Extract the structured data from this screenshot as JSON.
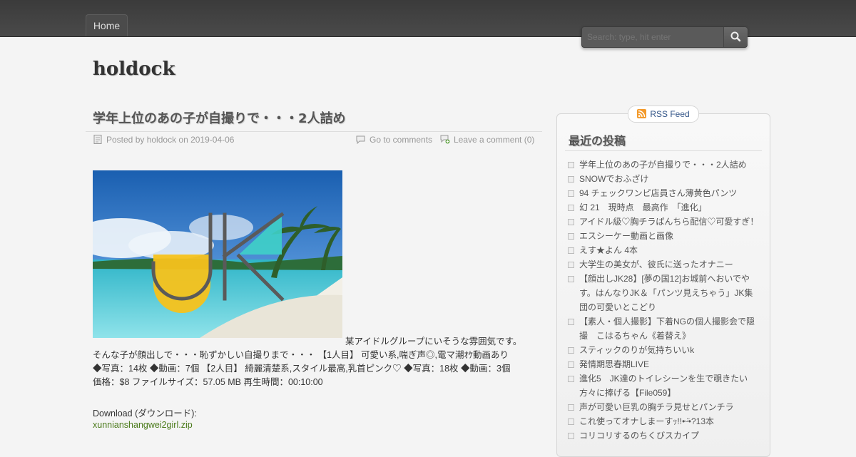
{
  "nav": {
    "home": "Home"
  },
  "search": {
    "placeholder": "Search: type, hit enter"
  },
  "site": {
    "title": "holdock"
  },
  "post": {
    "title": "学年上位のあの子が自撮りで・・・2人詰め",
    "posted_by": "Posted by holdock on 2019-04-06",
    "go_to_comments": "Go to comments",
    "leave_comment": "Leave a comment (0)",
    "image_label": "JK",
    "body_lines": [
      "某アイドルグループにいそうな雰囲気です。",
      "そんな子が顔出しで・・・恥ずかしい自撮りまで・・・ 【1人目】 可愛い系,喘ぎ声◎,電マ潮ｵｹ動画あり",
      "◆写真：14枚 ◆動画：7個 【2人目】 綺麗清楚系,スタイル最高,乳首ピンク♡ ◆写真：18枚 ◆動画：3個",
      "価格：$8 ファイルサイズ：57.05 MB 再生時間：00:10:00"
    ],
    "download_label": "Download (ダウンロード):",
    "download_link": "xunnianshangwei2girl.zip"
  },
  "sidebar": {
    "rss": "RSS Feed",
    "title": "最近の投稿",
    "items": [
      "学年上位のあの子が自撮りで・・・2人詰め",
      "SNOWでおふざけ",
      "94 チェックワンピ店員さん薄黄色パンツ",
      "幻 21　現時点　最高作　「進化」",
      "アイドル級♡胸チラぱんちら配信♡可愛すぎ！",
      "エスシーケー動画と画像",
      "えす★よん 4本",
      "大学生の美女が、彼氏に送ったオナニー",
      "【顔出しJK28】[夢の国12]お城前へおいでやす。はんなりJK＆「パンツ見えちゃう」JK集団の可愛いとこどり",
      "【素人・個人撮影】下着NGの個人撮影会で隠撮　こはるちゃん《着替え》",
      "スティックのりが気持ちいいk",
      "発情期思春期LIVE",
      "進化5　JK達のトイレシーンを生で覗きたい方々に捧げる【File059】",
      "声が可愛い巨乳の胸チラ見せとパンチラ",
      "これ使ってオナしまーすｯ!!•ᵕ̈•?13本",
      "コリコリするのちくびスカイプ"
    ]
  },
  "colors": {
    "topbar": "#3f3f3f",
    "link_green": "#4a7a1a",
    "rss_blue": "#335588"
  }
}
